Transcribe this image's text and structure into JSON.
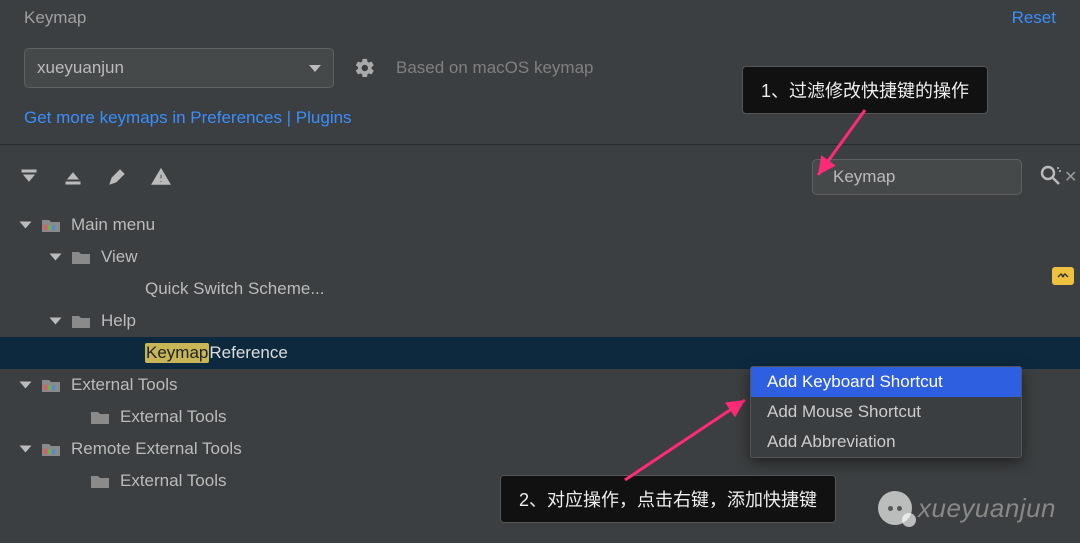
{
  "header": {
    "title": "Keymap",
    "reset": "Reset"
  },
  "scheme": {
    "selected": "xueyuanjun",
    "based_on": "Based on macOS keymap",
    "plugins_link": "Get more keymaps in Preferences | Plugins"
  },
  "search": {
    "value": "Keymap",
    "placeholder": ""
  },
  "tree": {
    "main_menu": "Main menu",
    "view": "View",
    "quick_switch": "Quick Switch Scheme...",
    "help": "Help",
    "keymap_hl": "Keymap",
    "keymap_ref_tail": " Reference",
    "external_tools": "External Tools",
    "external_tools_child": "External Tools",
    "remote_external": "Remote External Tools",
    "remote_external_child": "External Tools"
  },
  "context_menu": {
    "add_keyboard": "Add Keyboard Shortcut",
    "add_mouse": "Add Mouse Shortcut",
    "add_abbrev": "Add Abbreviation"
  },
  "annotations": {
    "a1": "1、过滤修改快捷键的操作",
    "a2": "2、对应操作，点击右键，添加快捷键"
  },
  "watermark": "xueyuanjun"
}
